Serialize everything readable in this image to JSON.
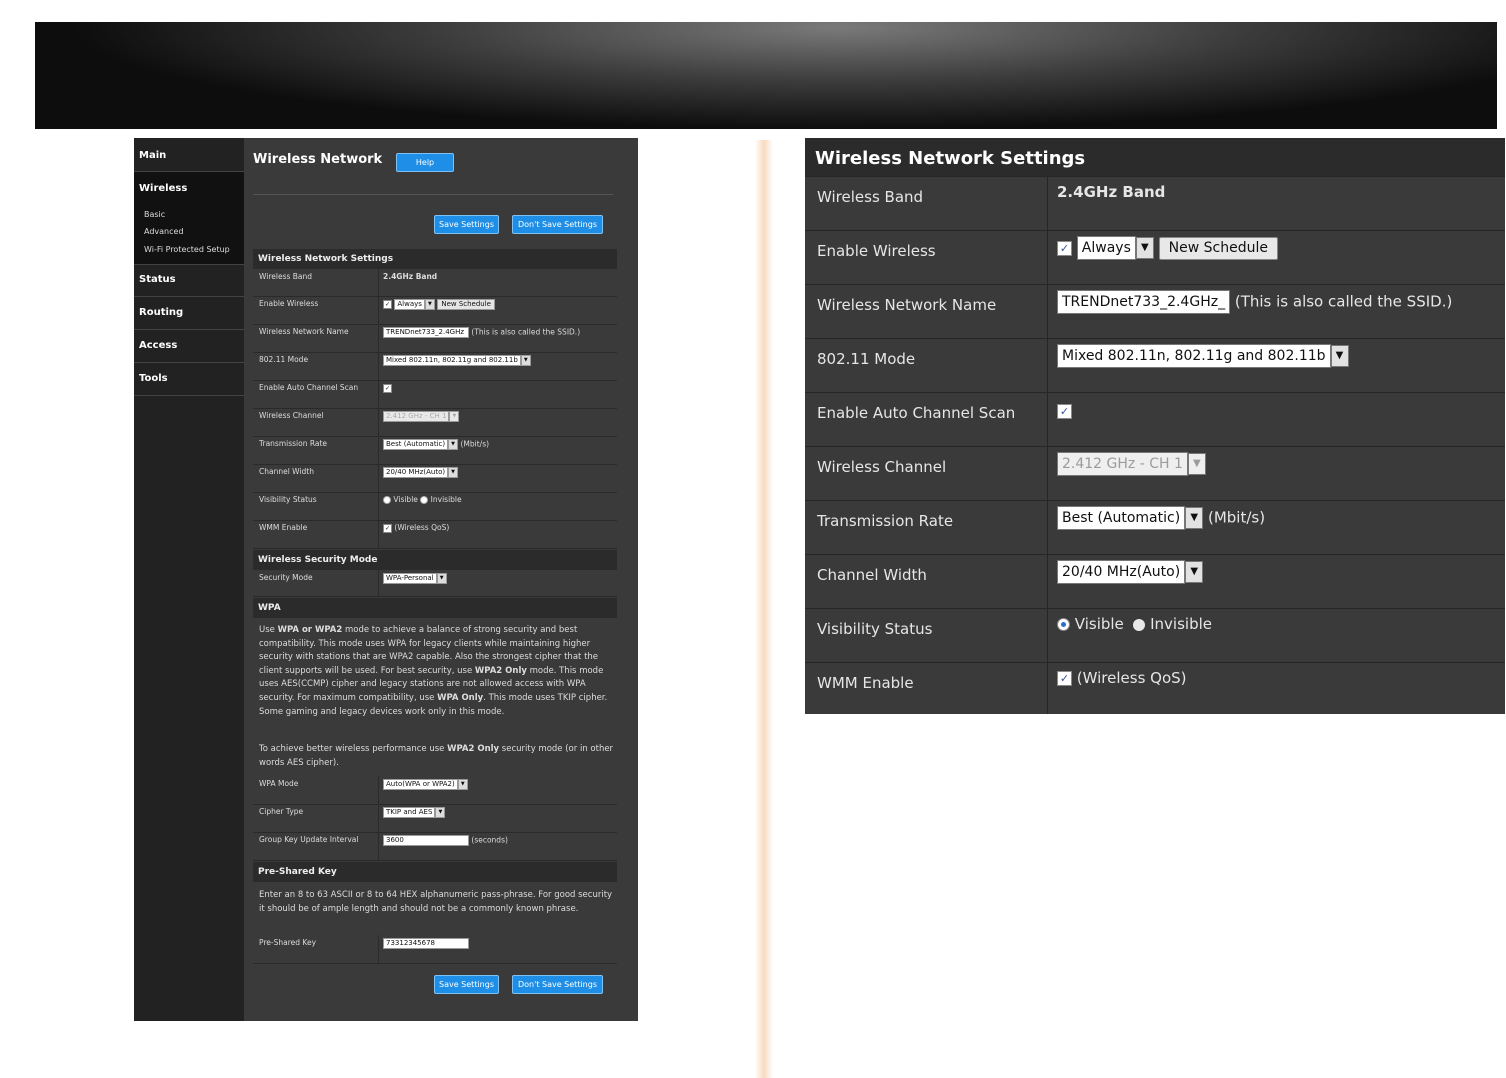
{
  "sidebar": {
    "main": "Main",
    "wireless": "Wireless",
    "basic": "Basic",
    "advanced": "Advanced",
    "wps": "Wi-Fi Protected Setup",
    "status": "Status",
    "routing": "Routing",
    "access": "Access",
    "tools": "Tools"
  },
  "page": {
    "title": "Wireless Network",
    "help": "Help",
    "save": "Save Settings",
    "dont_save": "Don't Save Settings"
  },
  "wns": {
    "header": "Wireless Network Settings",
    "band_label": "Wireless Band",
    "band_value": "2.4GHz Band",
    "enable_label": "Enable Wireless",
    "schedule": "Always",
    "new_schedule": "New Schedule",
    "name_label": "Wireless Network Name",
    "ssid": "TRENDnet733_2.4GHz_",
    "ssid_left": "TRENDnet733_2.4GHz",
    "ssid_note": "(This is also called the SSID.)",
    "mode_label": "802.11 Mode",
    "mode_value": "Mixed 802.11n, 802.11g and 802.11b",
    "autoscan_label": "Enable Auto Channel Scan",
    "channel_label": "Wireless Channel",
    "channel_value": "2.412 GHz - CH 1",
    "rate_label": "Transmission Rate",
    "rate_value": "Best (Automatic)",
    "rate_unit": "(Mbit/s)",
    "width_label": "Channel Width",
    "width_value": "20/40 MHz(Auto)",
    "visibility_label": "Visibility Status",
    "visible": "Visible",
    "invisible": "Invisible",
    "wmm_label": "WMM Enable",
    "wmm_note": "(Wireless QoS)"
  },
  "security": {
    "header": "Wireless Security Mode",
    "mode_label": "Security Mode",
    "mode_value": "WPA-Personal"
  },
  "wpa": {
    "header": "WPA",
    "p1_a": "Use ",
    "p1_b": "WPA or WPA2",
    "p1_c": " mode to achieve a balance of strong security and best compatibility. This mode uses WPA for legacy clients while maintaining higher security with stations that are WPA2 capable. Also the strongest cipher that the client supports will be used. For best security, use ",
    "p1_d": "WPA2 Only",
    "p1_e": " mode. This mode uses AES(CCMP) cipher and legacy stations are not allowed access with WPA security. For maximum compatibility, use ",
    "p1_f": "WPA Only",
    "p1_g": ". This mode uses TKIP cipher. Some gaming and legacy devices work only in this mode.",
    "p2_a": "To achieve better wireless performance use ",
    "p2_b": "WPA2 Only",
    "p2_c": " security mode (or in other words AES cipher).",
    "wpa_mode_label": "WPA Mode",
    "wpa_mode_value": "Auto(WPA or WPA2)",
    "cipher_label": "Cipher Type",
    "cipher_value": "TKIP and AES",
    "gkui_label": "Group Key Update Interval",
    "gkui_value": "3600",
    "gkui_unit": "(seconds)"
  },
  "psk": {
    "header": "Pre-Shared Key",
    "desc": "Enter an 8 to 63 ASCII or 8 to 64 HEX alphanumeric pass-phrase. For good security it should be of ample length and should not be a commonly known phrase.",
    "label": "Pre-Shared Key",
    "value": "73312345678"
  },
  "icons": {
    "dropdown": "dropdown-arrow-icon",
    "check": "checkbox-checked-icon",
    "radio": "radio-icon"
  },
  "colors": {
    "panel": "#3a3a3a",
    "header": "#2b2b2b",
    "button_blue": "#1e8ee6",
    "sidebar": "#222222"
  }
}
